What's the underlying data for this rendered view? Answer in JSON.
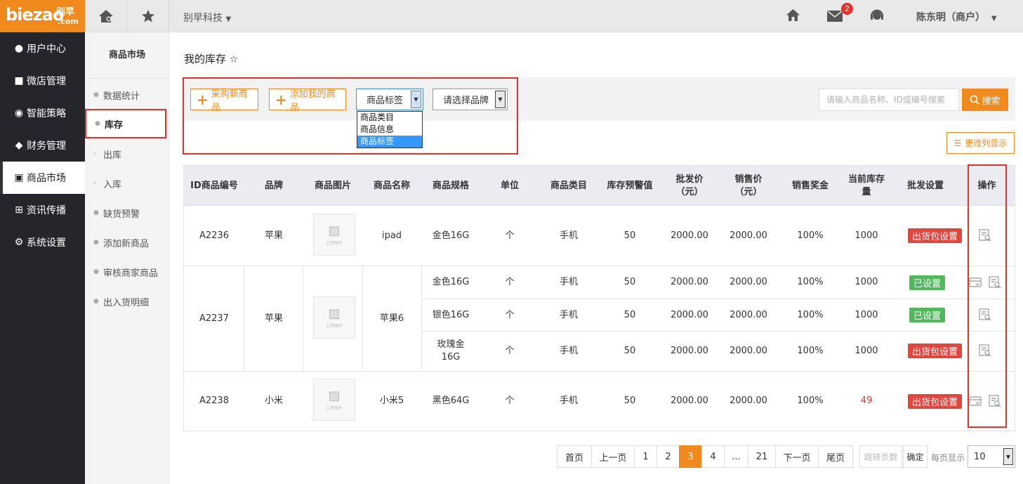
{
  "header": {
    "logo_text": "biezao",
    "logo_cn": "别早",
    "logo_com": ".com",
    "company": "别早科技",
    "mail_count": "2",
    "user": "陈东明（商户）"
  },
  "sidebar": {
    "items": [
      {
        "label": "用户中心",
        "icon": "user-icon"
      },
      {
        "label": "微店管理",
        "icon": "store-icon"
      },
      {
        "label": "智能策略",
        "icon": "strategy-icon"
      },
      {
        "label": "财务管理",
        "icon": "money-bag-icon"
      },
      {
        "label": "商品市场",
        "icon": "market-icon"
      },
      {
        "label": "资讯传播",
        "icon": "grid-icon"
      },
      {
        "label": "系统设置",
        "icon": "gear-icon"
      }
    ]
  },
  "subside": {
    "title": "商品市场",
    "items": [
      "数据统计",
      "库存",
      "出库",
      "入库",
      "缺货预警",
      "添加新商品",
      "审核商家商品",
      "出入货明细"
    ]
  },
  "page": {
    "title": "我的库存"
  },
  "toolbar": {
    "buy_new": "采购新商品",
    "add_mine": "添加我的商品",
    "tag_select": "商品标签",
    "brand_select": "请选择品牌",
    "dropdown_options": [
      "商品类目",
      "商品信息",
      "商品标签"
    ],
    "search_placeholder": "请输入商品名称、ID或编号搜索",
    "search_btn": "搜索",
    "change_columns": "更改列显示"
  },
  "table": {
    "headers": [
      "ID商品编号",
      "品牌",
      "商品图片",
      "商品名称",
      "商品规格",
      "单位",
      "商品类目",
      "库存预警值",
      "批发价（元）",
      "销售价（元）",
      "销售奖金",
      "当前库存量",
      "批发设置",
      "操作"
    ],
    "image_placeholder": "上传图片",
    "products": [
      {
        "id": "A2236",
        "brand": "苹果",
        "name": "ipad",
        "variants": [
          {
            "spec": "金色16G",
            "unit": "个",
            "category": "手机",
            "warn": "50",
            "wholesale": "2000.00",
            "sale": "2000.00",
            "bonus": "100%",
            "stock": "1000",
            "setting": "出货包设置"
          }
        ]
      },
      {
        "id": "A2237",
        "brand": "苹果",
        "name": "苹果6",
        "variants": [
          {
            "spec": "金色16G",
            "unit": "个",
            "category": "手机",
            "warn": "50",
            "wholesale": "2000.00",
            "sale": "2000.00",
            "bonus": "100%",
            "stock": "1000",
            "setting": "已设置"
          },
          {
            "spec": "银色16G",
            "unit": "个",
            "category": "手机",
            "warn": "50",
            "wholesale": "2000.00",
            "sale": "2000.00",
            "bonus": "100%",
            "stock": "1000",
            "setting": "已设置"
          },
          {
            "spec": "玫瑰金16G",
            "unit": "个",
            "category": "手机",
            "warn": "50",
            "wholesale": "2000.00",
            "sale": "2000.00",
            "bonus": "100%",
            "stock": "1000",
            "setting": "出货包设置"
          }
        ]
      },
      {
        "id": "A2238",
        "brand": "小米",
        "name": "小米5",
        "variants": [
          {
            "spec": "黑色64G",
            "unit": "个",
            "category": "手机",
            "warn": "50",
            "wholesale": "2000.00",
            "sale": "2000.00",
            "bonus": "100%",
            "stock": "49",
            "setting": "出货包设置"
          }
        ]
      }
    ]
  },
  "colors": {
    "accent": "#f08a1c",
    "danger": "#e3453c",
    "success": "#52b85c",
    "sidebar": "#25262b"
  },
  "pagination": {
    "pages": [
      "首页",
      "上一页",
      "1",
      "2",
      "3",
      "4",
      "...",
      "21",
      "下一页",
      "尾页"
    ],
    "current": "3",
    "jump_placeholder": "跳转页数",
    "confirm": "确定",
    "per_page_label": "每页显示",
    "per_page": "10"
  }
}
